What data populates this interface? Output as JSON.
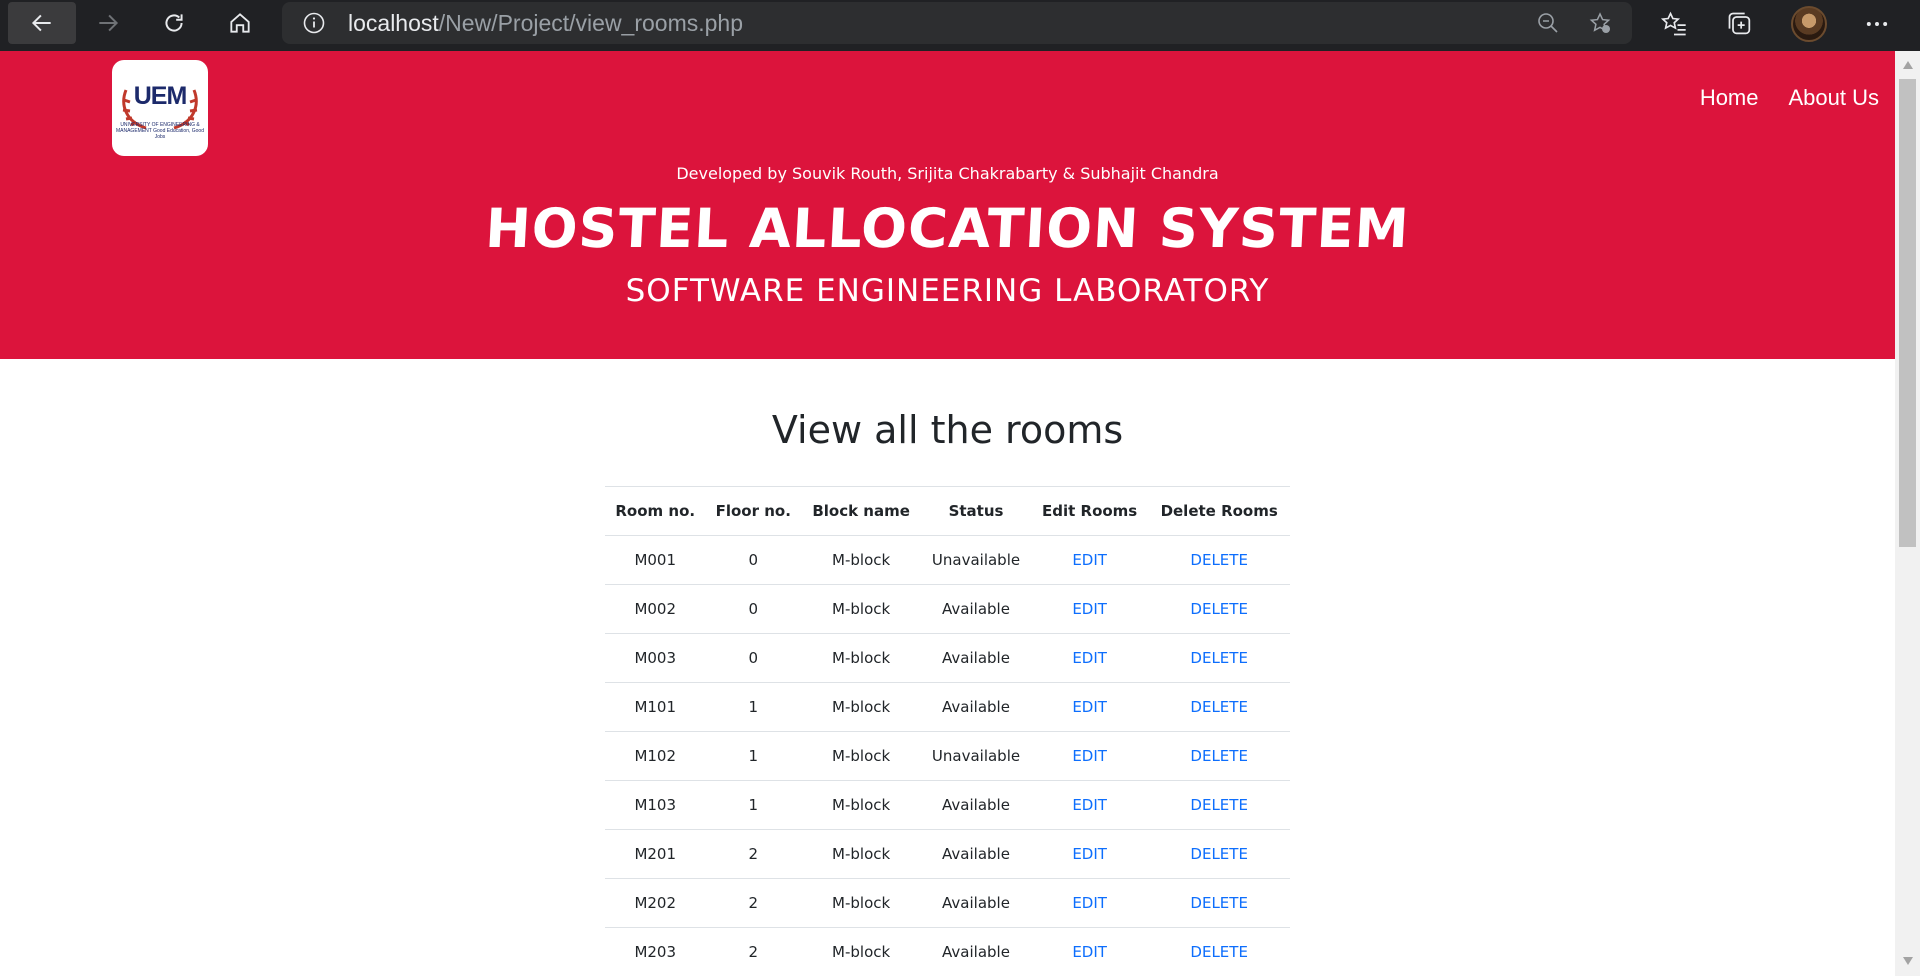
{
  "browser": {
    "url_host": "localhost",
    "url_path": "/New/Project/view_rooms.php"
  },
  "header": {
    "logo_text": "UEM",
    "logo_subtext": "UNIVERSITY OF ENGINEERING & MANAGEMENT Good Education, Good Jobs",
    "nav": {
      "home": "Home",
      "about": "About Us"
    },
    "developed_by": "Developed by Souvik Routh, Srijita Chakrabarty & Subhajit Chandra",
    "title": "HOSTEL ALLOCATION SYSTEM",
    "subtitle": "SOFTWARE ENGINEERING LABORATORY"
  },
  "main": {
    "heading": "View all the rooms",
    "columns": [
      "Room no.",
      "Floor no.",
      "Block name",
      "Status",
      "Edit Rooms",
      "Delete Rooms"
    ],
    "rows": [
      {
        "room": "M001",
        "floor": "0",
        "block": "M-block",
        "status": "Unavailable",
        "edit": "EDIT",
        "delete": "DELETE"
      },
      {
        "room": "M002",
        "floor": "0",
        "block": "M-block",
        "status": "Available",
        "edit": "EDIT",
        "delete": "DELETE"
      },
      {
        "room": "M003",
        "floor": "0",
        "block": "M-block",
        "status": "Available",
        "edit": "EDIT",
        "delete": "DELETE"
      },
      {
        "room": "M101",
        "floor": "1",
        "block": "M-block",
        "status": "Available",
        "edit": "EDIT",
        "delete": "DELETE"
      },
      {
        "room": "M102",
        "floor": "1",
        "block": "M-block",
        "status": "Unavailable",
        "edit": "EDIT",
        "delete": "DELETE"
      },
      {
        "room": "M103",
        "floor": "1",
        "block": "M-block",
        "status": "Available",
        "edit": "EDIT",
        "delete": "DELETE"
      },
      {
        "room": "M201",
        "floor": "2",
        "block": "M-block",
        "status": "Available",
        "edit": "EDIT",
        "delete": "DELETE"
      },
      {
        "room": "M202",
        "floor": "2",
        "block": "M-block",
        "status": "Available",
        "edit": "EDIT",
        "delete": "DELETE"
      },
      {
        "room": "M203",
        "floor": "2",
        "block": "M-block",
        "status": "Available",
        "edit": "EDIT",
        "delete": "DELETE"
      }
    ]
  },
  "colors": {
    "header_bg": "#dc143c",
    "link": "#0d6efd",
    "chrome_bg": "#202124"
  },
  "icons": {
    "back": "back-arrow-icon",
    "forward": "forward-arrow-icon",
    "refresh": "refresh-icon",
    "home": "home-icon",
    "info": "info-icon",
    "zoom": "zoom-out-icon",
    "favorite_add": "add-favorite-icon",
    "favorites": "favorites-icon",
    "collections": "collections-icon",
    "profile": "profile-avatar",
    "menu": "more-menu-icon"
  }
}
